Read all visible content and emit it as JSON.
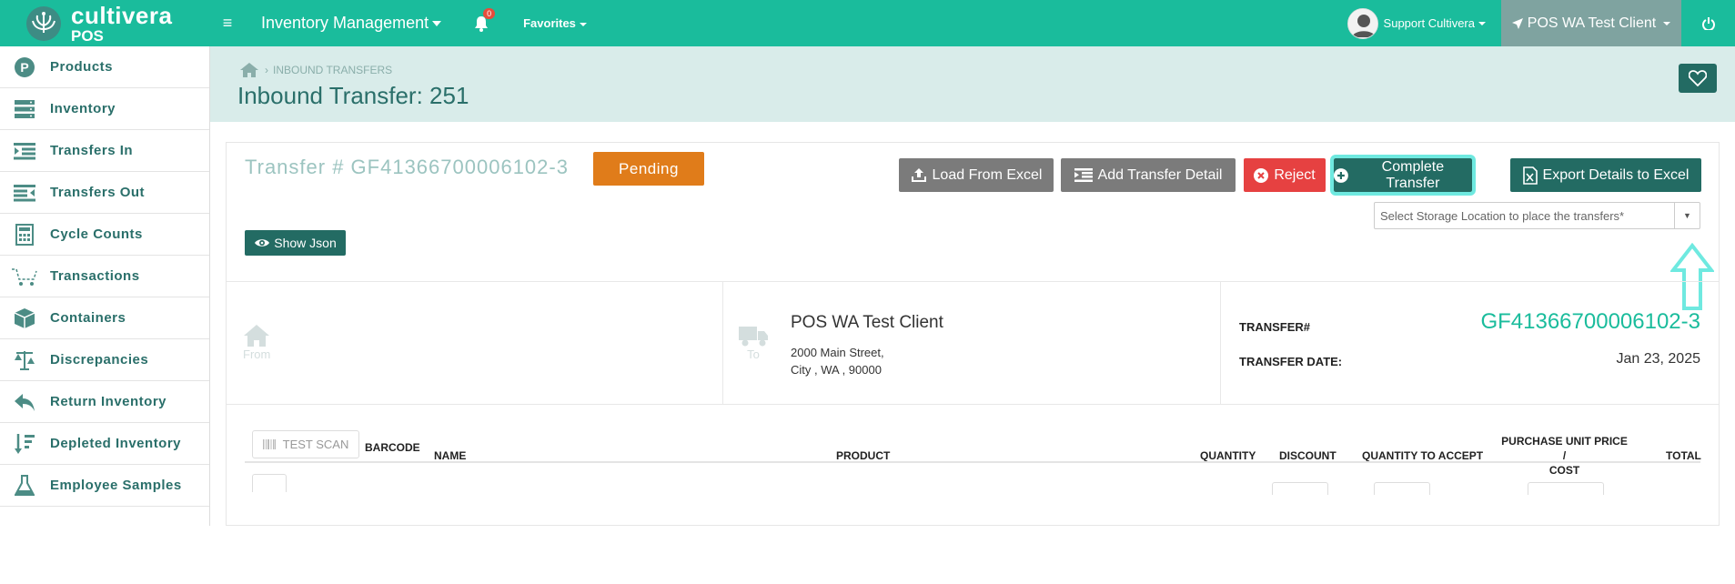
{
  "topbar": {
    "brand_name": "cultivera",
    "brand_sub": "POS",
    "menu_title": "Inventory Management",
    "notification_count": "0",
    "favorites_label": "Favorites",
    "user_name": "Support Cultivera",
    "client_name": "POS WA Test Client"
  },
  "sidebar": {
    "items": [
      {
        "label": "Products",
        "icon": "products-icon"
      },
      {
        "label": "Inventory",
        "icon": "inventory-icon"
      },
      {
        "label": "Transfers In",
        "icon": "transfers-in-icon"
      },
      {
        "label": "Transfers Out",
        "icon": "transfers-out-icon"
      },
      {
        "label": "Cycle Counts",
        "icon": "calculator-icon"
      },
      {
        "label": "Transactions",
        "icon": "cart-icon"
      },
      {
        "label": "Containers",
        "icon": "box-icon"
      },
      {
        "label": "Discrepancies",
        "icon": "scale-icon"
      },
      {
        "label": "Return Inventory",
        "icon": "reply-icon"
      },
      {
        "label": "Depleted Inventory",
        "icon": "sort-down-icon"
      },
      {
        "label": "Employee Samples",
        "icon": "flask-icon"
      }
    ]
  },
  "header": {
    "breadcrumb_current": "INBOUND TRANSFERS",
    "title": "Inbound Transfer: 251"
  },
  "transfer": {
    "number_label": "Transfer # GF41366700006102-3",
    "status": "Pending",
    "storage_placeholder": "Select Storage Location to place the transfers*"
  },
  "actions": {
    "load_excel": "Load From Excel",
    "add_detail": "Add Transfer Detail",
    "reject": "Reject",
    "complete": "Complete Transfer",
    "export": "Export Details to Excel",
    "show_json": "Show Json"
  },
  "info": {
    "from_label": "From",
    "to_label": "To",
    "to_name": "POS WA Test Client",
    "to_address_line1": "2000 Main Street,",
    "to_address_line2": "City , WA , 90000",
    "transfer_no_label": "TRANSFER#",
    "transfer_no_value": "GF41366700006102-3",
    "transfer_date_label": "TRANSFER DATE:",
    "transfer_date_value": "Jan 23, 2025"
  },
  "table": {
    "test_scan": "TEST SCAN",
    "columns": {
      "barcode": "BARCODE",
      "name": "NAME",
      "product": "PRODUCT",
      "quantity": "QUANTITY",
      "discount": "DISCOUNT",
      "quantity_to_accept": "QUANTITY TO ACCEPT",
      "price_line1": "PURCHASE UNIT PRICE /",
      "price_line2": "COST",
      "total": "TOTAL"
    }
  },
  "colors": {
    "brand": "#1abc9c",
    "dark_teal": "#236b63",
    "pending": "#e07c1a",
    "reject": "#e64141",
    "highlight": "#6fe9e0"
  }
}
